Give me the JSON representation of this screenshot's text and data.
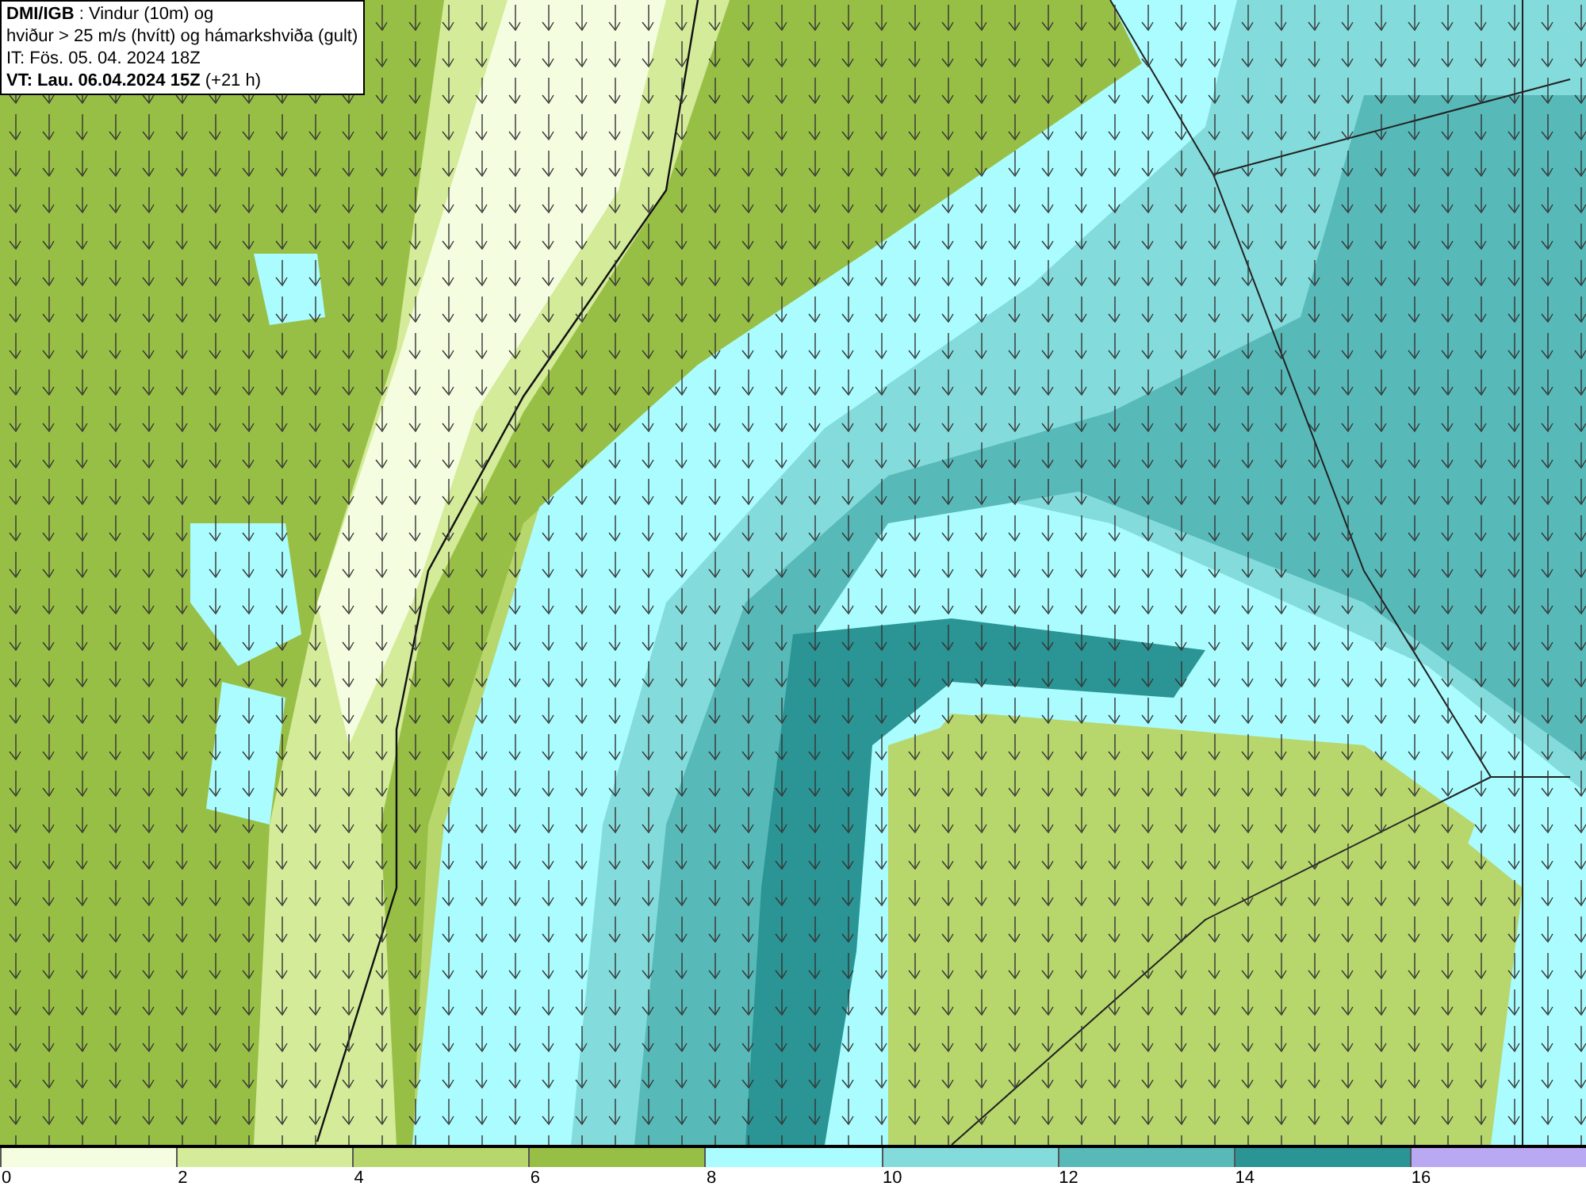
{
  "header": {
    "lines": [
      "**DMI/IGB** : Vindur (10m) og",
      "hviður > 25 m/s (hvítt) og hámarkshviða (gult)",
      "IT: Fös. 05. 04. 2024 18Z",
      "**VT: Lau. 06.04.2024 15Z** (+21 h)"
    ]
  },
  "legend": {
    "bins": [
      {
        "label": "0",
        "color": "#f5fde0"
      },
      {
        "label": "2",
        "color": "#d4eb9a"
      },
      {
        "label": "4",
        "color": "#b7d66c"
      },
      {
        "label": "6",
        "color": "#98bf45"
      },
      {
        "label": "8",
        "color": "#aafcff"
      },
      {
        "label": "10",
        "color": "#84dbdc"
      },
      {
        "label": "12",
        "color": "#58b9b9"
      },
      {
        "label": "14",
        "color": "#2b9494"
      },
      {
        "label": "16",
        "color": "#b9a8f2"
      }
    ]
  }
}
